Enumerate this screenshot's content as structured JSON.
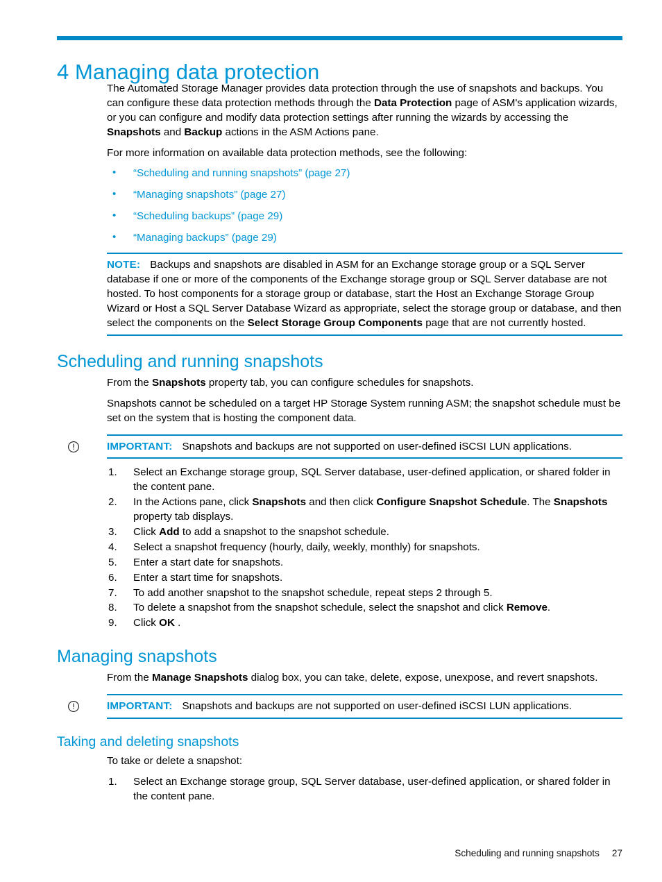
{
  "colors": {
    "accent_blue": "#0096d6",
    "rule_blue": "#0089c4",
    "text_black": "#000000"
  },
  "chapter": {
    "title": "4 Managing data protection"
  },
  "intro": {
    "paragraph1_part1": "The Automated Storage Manager provides data protection through the use of snapshots and backups. You can configure these data protection methods through the ",
    "paragraph1_bold1": "Data Protection",
    "paragraph1_part2": " page of ASM's application wizards, or you can configure and modify data protection settings after running the wizards by accessing the  ",
    "paragraph1_bold2": "Snapshots",
    "paragraph1_part3": " and ",
    "paragraph1_bold3": "Backup",
    "paragraph1_part4": " actions in the ASM Actions pane.",
    "paragraph2": "For more information on available data protection methods, see the following:"
  },
  "link_list": {
    "bullet_glyph": "•",
    "items": [
      {
        "text": "“Scheduling and running snapshots” (page 27)"
      },
      {
        "text": "“Managing snapshots” (page 27)"
      },
      {
        "text": "“Scheduling backups” (page 29)"
      },
      {
        "text": "“Managing backups” (page 29)"
      }
    ]
  },
  "note_block": {
    "label": "NOTE:",
    "text_part1": "Backups and snapshots are disabled in ASM for an Exchange storage group or a SQL Server database if one or more of the components of the Exchange storage group or SQL Server database are not hosted. To host components for a storage group or database, start the Host an Exchange Storage Group Wizard or Host a SQL Server Database Wizard as appropriate, select the storage group or database, and then select the components on the ",
    "bold1": "Select Storage Group Components",
    "text_part2": " page that are not currently hosted."
  },
  "section_scheduling": {
    "heading": "Scheduling and running snapshots",
    "paragraph1_part1": "From the ",
    "paragraph1_bold1": "Snapshots",
    "paragraph1_part2": " property tab, you can configure schedules for snapshots.",
    "paragraph2": "Snapshots cannot be scheduled on a target HP Storage System running ASM; the snapshot schedule must be set on the system that is hosting the component data."
  },
  "important_block_1": {
    "icon": "important-circle-exclamation-icon",
    "label": "IMPORTANT:",
    "text": "Snapshots and backups are not supported on user-defined iSCSI LUN applications."
  },
  "scheduling_steps": [
    {
      "num": "1.",
      "part1": "Select an Exchange storage group, SQL Server database, user-defined application, or shared folder in the content pane.",
      "bold1": "",
      "part2": "",
      "bold2": "",
      "part3": "",
      "bold3": "",
      "part4": ""
    },
    {
      "num": "2.",
      "part1": "In the Actions pane, click ",
      "bold1": "Snapshots",
      "part2": " and then click ",
      "bold2": "Configure Snapshot Schedule",
      "part3": ". The ",
      "bold3": "Snapshots",
      "part4": " property tab displays."
    },
    {
      "num": "3.",
      "part1": "Click ",
      "bold1": "Add",
      "part2": " to add a snapshot to the snapshot schedule.",
      "bold2": "",
      "part3": "",
      "bold3": "",
      "part4": ""
    },
    {
      "num": "4.",
      "part1": "Select a snapshot frequency (hourly, daily, weekly, monthly) for snapshots.",
      "bold1": "",
      "part2": "",
      "bold2": "",
      "part3": "",
      "bold3": "",
      "part4": ""
    },
    {
      "num": "5.",
      "part1": "Enter a start date for snapshots.",
      "bold1": "",
      "part2": "",
      "bold2": "",
      "part3": "",
      "bold3": "",
      "part4": ""
    },
    {
      "num": "6.",
      "part1": "Enter a start time for snapshots.",
      "bold1": "",
      "part2": "",
      "bold2": "",
      "part3": "",
      "bold3": "",
      "part4": ""
    },
    {
      "num": "7.",
      "part1": "To add another snapshot to the snapshot schedule, repeat steps 2 through 5.",
      "bold1": "",
      "part2": "",
      "bold2": "",
      "part3": "",
      "bold3": "",
      "part4": ""
    },
    {
      "num": "8.",
      "part1": "To delete a snapshot from the snapshot schedule, select the snapshot and click ",
      "bold1": "Remove",
      "part2": ".",
      "bold2": "",
      "part3": "",
      "bold3": "",
      "part4": ""
    },
    {
      "num": "9.",
      "part1": "Click ",
      "bold1": "OK",
      "part2": " .",
      "bold2": "",
      "part3": "",
      "bold3": "",
      "part4": ""
    }
  ],
  "section_managing": {
    "heading": "Managing snapshots",
    "paragraph1_part1": "From the ",
    "paragraph1_bold1": "Manage Snapshots",
    "paragraph1_part2": " dialog box, you can take, delete, expose, unexpose, and revert snapshots."
  },
  "important_block_2": {
    "icon": "important-circle-exclamation-icon",
    "label": "IMPORTANT:",
    "text": "Snapshots and backups are not supported on user-defined iSCSI LUN applications."
  },
  "section_taking": {
    "heading": "Taking and deleting snapshots",
    "paragraph1": "To take or delete a snapshot:"
  },
  "taking_steps": [
    {
      "num": "1.",
      "part1": "Select an Exchange storage group, SQL Server database, user-defined application, or shared folder in the content pane.",
      "bold1": "",
      "part2": "",
      "bold2": "",
      "part3": "",
      "bold3": "",
      "part4": ""
    }
  ],
  "footer": {
    "section_label": "Scheduling and running snapshots",
    "page_number": "27"
  }
}
